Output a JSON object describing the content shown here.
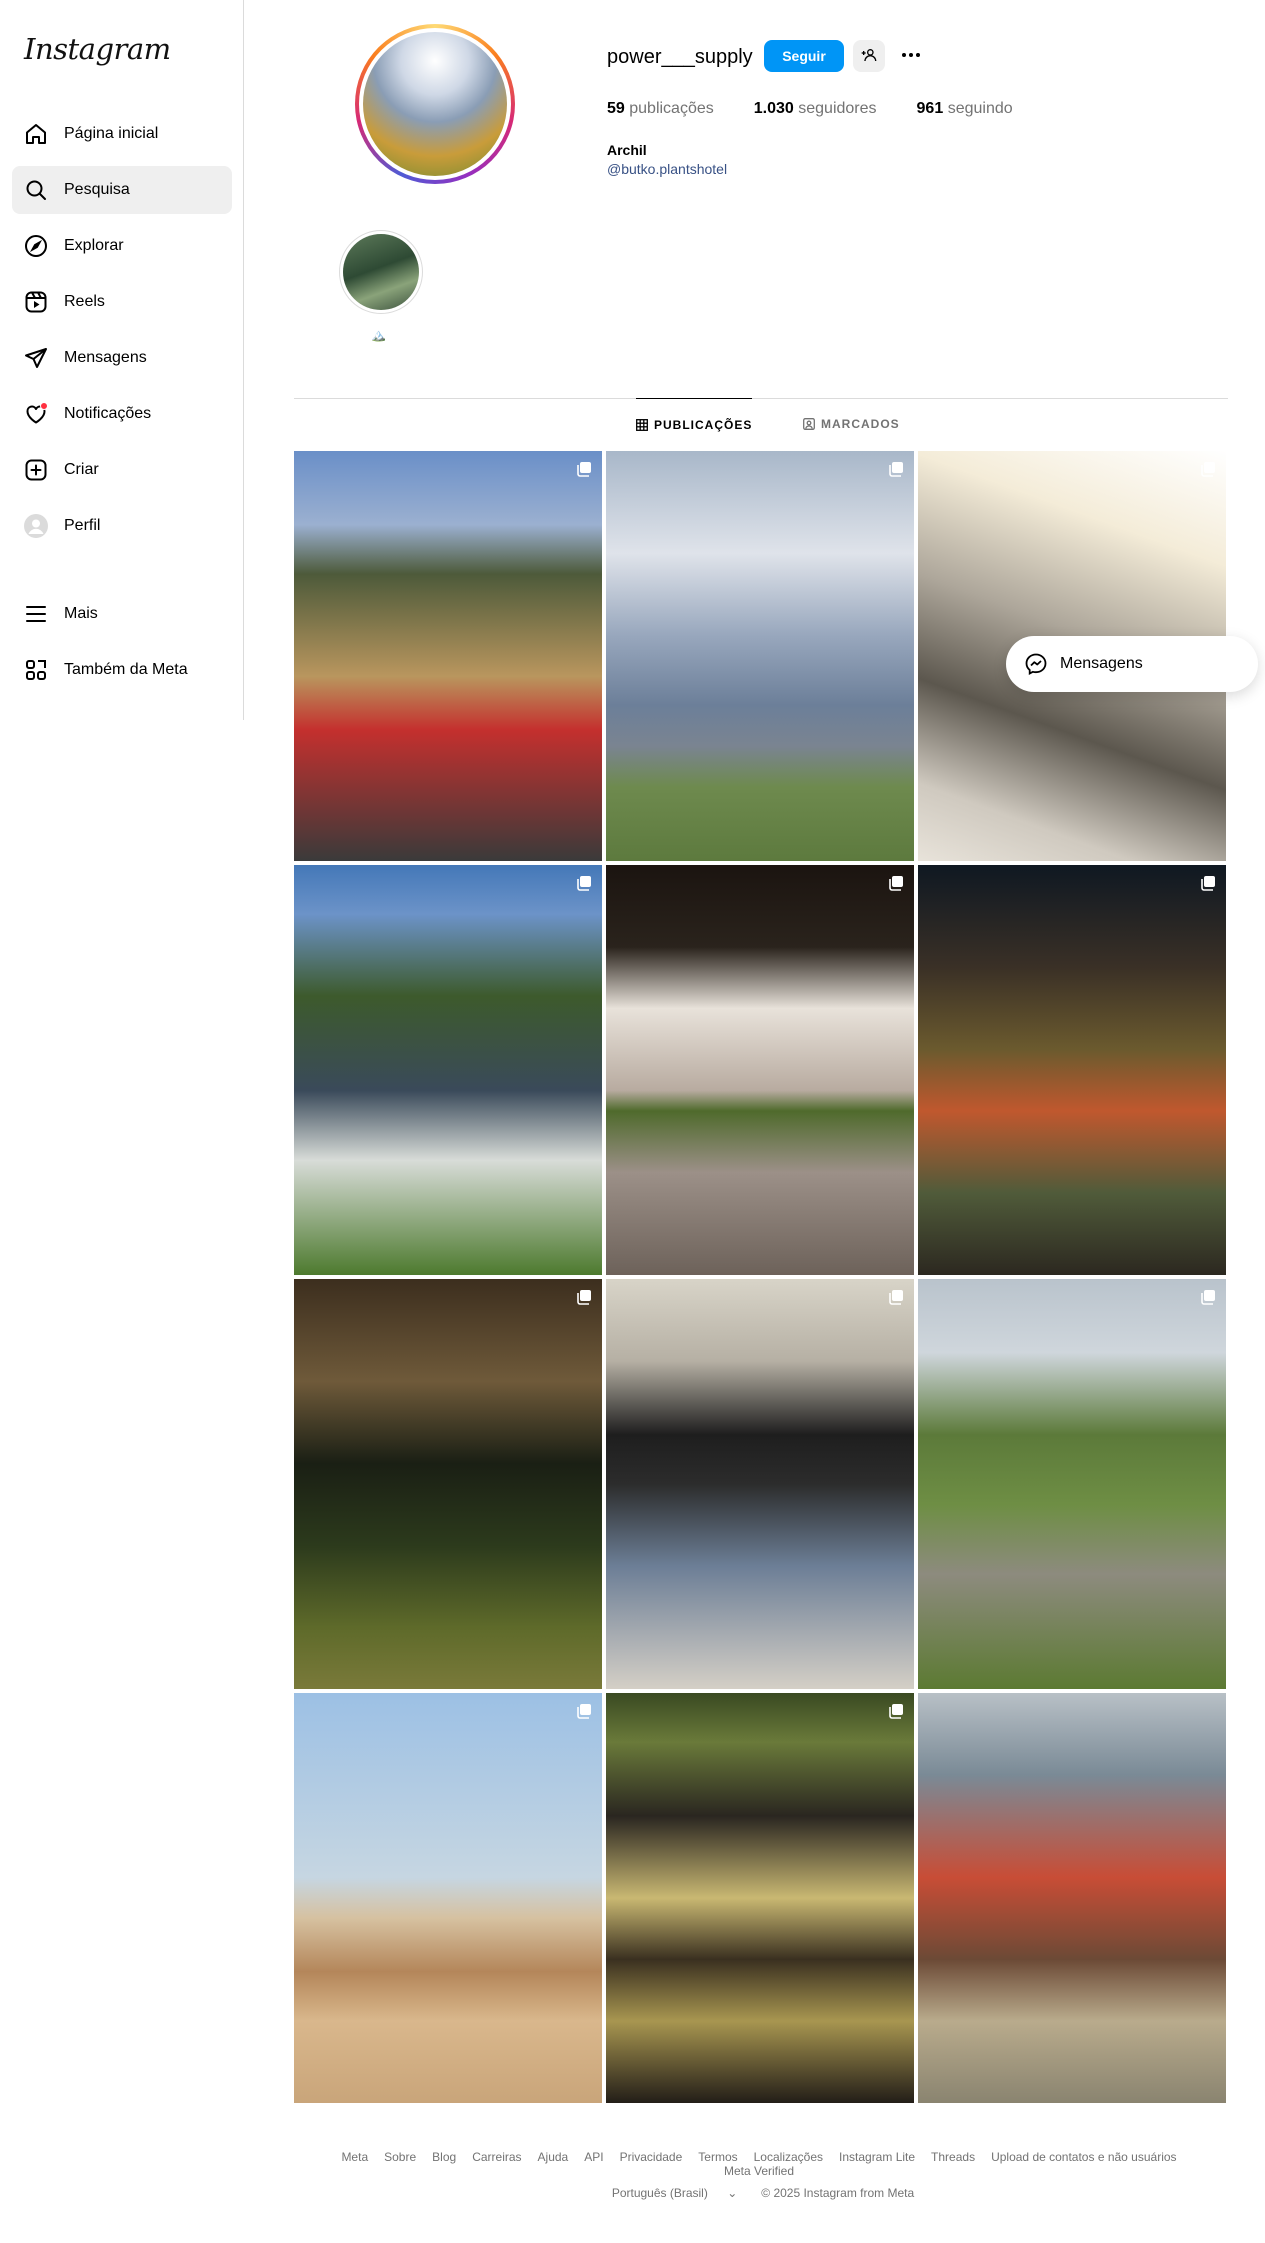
{
  "app": {
    "logo": "Instagram"
  },
  "sidebar": {
    "items": [
      {
        "label": "Página inicial",
        "icon": "home-icon"
      },
      {
        "label": "Pesquisa",
        "icon": "search-icon"
      },
      {
        "label": "Explorar",
        "icon": "compass-icon"
      },
      {
        "label": "Reels",
        "icon": "reels-icon"
      },
      {
        "label": "Mensagens",
        "icon": "send-icon"
      },
      {
        "label": "Notificações",
        "icon": "heart-icon"
      },
      {
        "label": "Criar",
        "icon": "plus-square-icon"
      },
      {
        "label": "Perfil",
        "icon": "profile-avatar-icon"
      },
      {
        "label": "Mais",
        "icon": "menu-icon"
      },
      {
        "label": "Também da Meta",
        "icon": "meta-apps-icon"
      }
    ],
    "active": "Pesquisa"
  },
  "profile": {
    "username": "power___supply",
    "follow_label": "Seguir",
    "stats": {
      "posts_count": "59",
      "posts_label": "publicações",
      "followers_count": "1.030",
      "followers_label": "seguidores",
      "following_count": "961",
      "following_label": "seguindo"
    },
    "bio_name": "Archil",
    "bio_link": "@butko.plantshotel",
    "highlight_label": "🏔️"
  },
  "tabs": [
    {
      "label": "PUBLICAÇÕES",
      "icon": "grid-icon",
      "active": true
    },
    {
      "label": "MARCADOS",
      "icon": "tagged-icon",
      "active": false
    }
  ],
  "posts": [
    {
      "subject": "man in red striped shirt at outdoor beer garden",
      "multi": true
    },
    {
      "subject": "cloudy sky over mountains",
      "multi": true
    },
    {
      "subject": "man with flowers by sunlit window",
      "multi": true
    },
    {
      "subject": "man in jacket in green field",
      "multi": true
    },
    {
      "subject": "stairwell with moss balls",
      "multi": true
    },
    {
      "subject": "man in orange shirt on balcony at night",
      "multi": true
    },
    {
      "subject": "sword monuments on hillside",
      "multi": true
    },
    {
      "subject": "man sitting on floor with plants",
      "multi": true
    },
    {
      "subject": "hiker with dog near tower ruins",
      "multi": true
    },
    {
      "subject": "desert sand dunes",
      "multi": true
    },
    {
      "subject": "mushrooms on tree stump",
      "multi": true
    },
    {
      "subject": "man taking selfie in subway station",
      "multi": false
    }
  ],
  "messages_pill": {
    "label": "Mensagens"
  },
  "footer": {
    "links": [
      "Meta",
      "Sobre",
      "Blog",
      "Carreiras",
      "Ajuda",
      "API",
      "Privacidade",
      "Termos",
      "Localizações",
      "Instagram Lite",
      "Threads",
      "Upload de contatos e não usuários",
      "Meta Verified"
    ],
    "language": "Português (Brasil)",
    "copyright": "© 2025 Instagram from Meta"
  },
  "colors": {
    "accent": "#0095f6",
    "link": "#385185",
    "notification": "#ff3040"
  }
}
